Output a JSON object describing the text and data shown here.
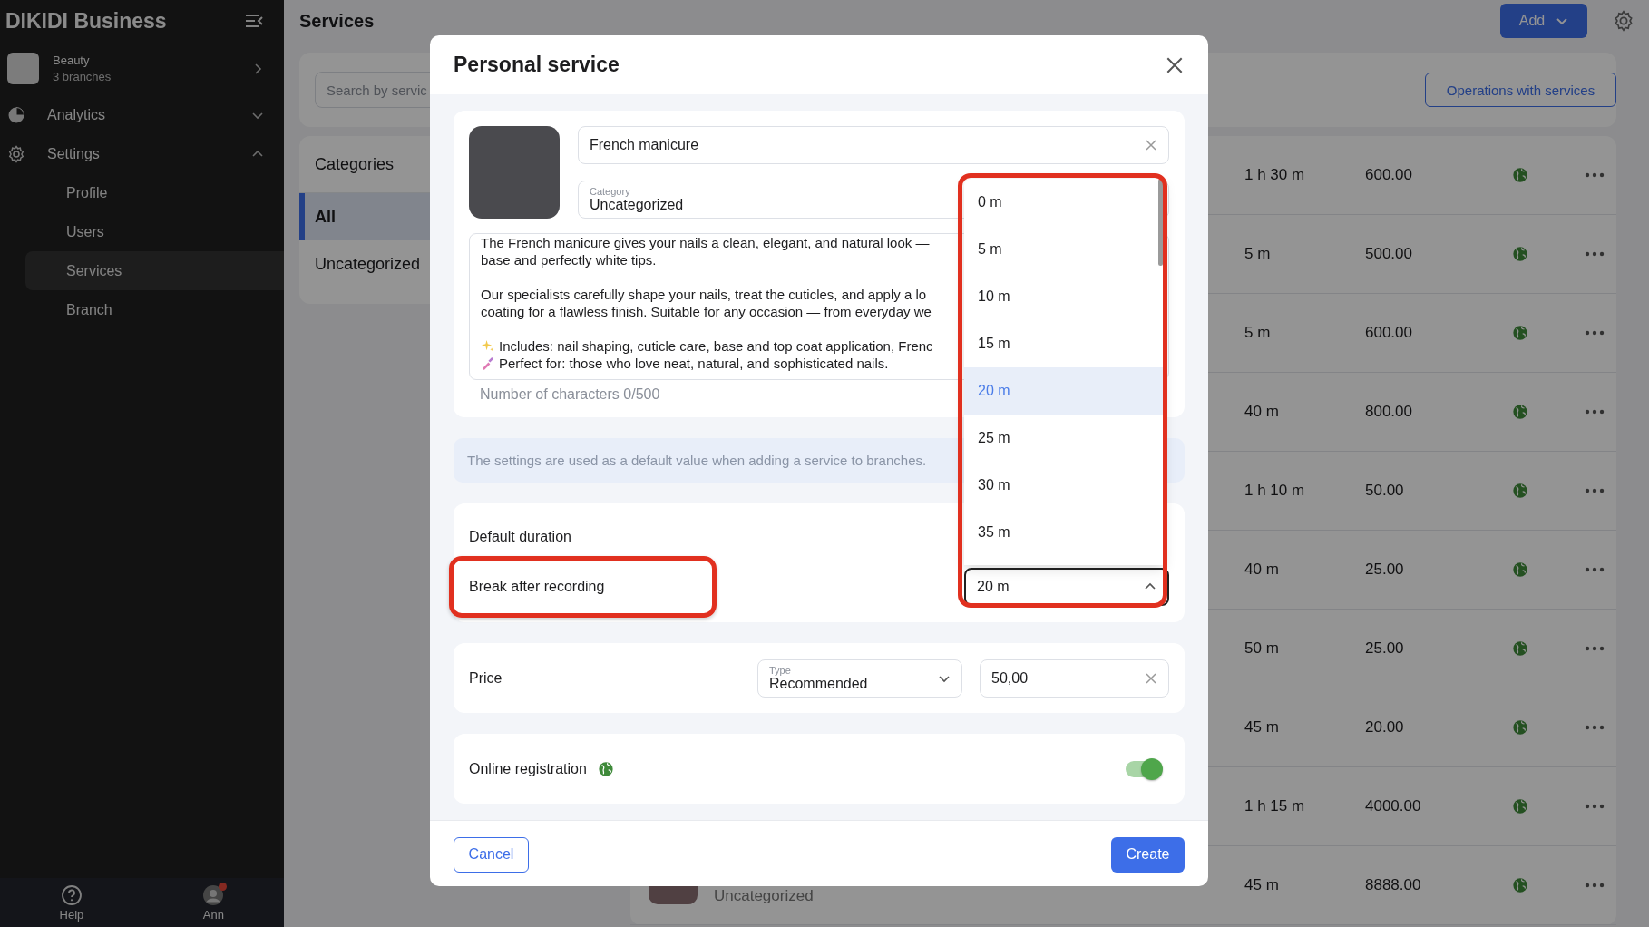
{
  "sidebar": {
    "brand": "DIKIDI Business",
    "account": {
      "name": "Beauty",
      "subtitle": "3 branches"
    },
    "items": [
      {
        "label": "Analytics",
        "expanded": false
      },
      {
        "label": "Settings",
        "expanded": true,
        "children": [
          {
            "label": "Profile",
            "selected": false
          },
          {
            "label": "Users",
            "selected": false
          },
          {
            "label": "Services",
            "selected": true
          },
          {
            "label": "Branch",
            "selected": false
          }
        ]
      }
    ],
    "footer": [
      {
        "label": "Help",
        "notification": false
      },
      {
        "label": "Ann",
        "notification": true
      }
    ]
  },
  "main": {
    "title": "Services",
    "add_button": "Add",
    "search": {
      "placeholder": "Search by servic"
    },
    "operations_button": "Operations with services",
    "categories": {
      "title": "Categories",
      "items": [
        {
          "label": "All",
          "selected": true
        },
        {
          "label": "Uncategorized",
          "selected": false
        }
      ]
    },
    "rows": [
      {
        "duration": "1 h 30 m",
        "price": "600.00",
        "online": true
      },
      {
        "duration": "5 m",
        "price": "500.00",
        "online": true
      },
      {
        "duration": "5 m",
        "price": "600.00",
        "online": true
      },
      {
        "duration": "40 m",
        "price": "800.00",
        "online": true
      },
      {
        "duration": "1 h 10 m",
        "price": "50.00",
        "online": true
      },
      {
        "duration": "40 m",
        "price": "25.00",
        "online": true
      },
      {
        "duration": "50 m",
        "price": "25.00",
        "online": true
      },
      {
        "duration": "45 m",
        "price": "20.00",
        "online": true
      },
      {
        "duration": "1 h 15 m",
        "price": "4000.00",
        "online": true
      },
      {
        "category": "Uncategorized",
        "duration": "45 m",
        "price": "8888.00",
        "online": true
      }
    ]
  },
  "modal": {
    "title": "Personal service",
    "name": {
      "value": "French manicure"
    },
    "category": {
      "label": "Category",
      "value": "Uncategorized"
    },
    "description": {
      "paragraphs": [
        [
          {
            "text": "The French manicure gives your nails a clean, elegant, and natural look —",
            "bullet": false
          },
          {
            "text": "base and perfectly white tips.",
            "bullet": false
          }
        ],
        [
          {
            "text": "Our specialists carefully shape your nails, treat the cuticles, and apply a lo",
            "bullet": false
          },
          {
            "text": "coating for a flawless finish. Suitable for any occasion — from everyday we",
            "bullet": false
          }
        ],
        [
          {
            "text": "Includes: nail shaping, cuticle care, base and top coat application, Frenc",
            "bullet": true
          },
          {
            "text": "Perfect for: those who love neat, natural, and sophisticated nails.",
            "bullet": true
          }
        ]
      ],
      "counter": "Number of characters 0/500"
    },
    "info": "The settings are used as a default value when adding a service to branches.",
    "duration": {
      "label": "Default duration"
    },
    "break": {
      "label": "Break after recording",
      "value": "20 m",
      "open": true,
      "options": [
        {
          "label": "0 m",
          "selected": false
        },
        {
          "label": "5 m",
          "selected": false
        },
        {
          "label": "10 m",
          "selected": false
        },
        {
          "label": "15 m",
          "selected": false
        },
        {
          "label": "20 m",
          "selected": true
        },
        {
          "label": "25 m",
          "selected": false
        },
        {
          "label": "30 m",
          "selected": false
        },
        {
          "label": "35 m",
          "selected": false
        }
      ]
    },
    "price": {
      "label": "Price",
      "type": {
        "label": "Type",
        "value": "Recommended"
      },
      "value": "50,00"
    },
    "online": {
      "label": "Online registration",
      "on": true
    },
    "cancel_button": "Cancel",
    "create_button": "Create"
  }
}
